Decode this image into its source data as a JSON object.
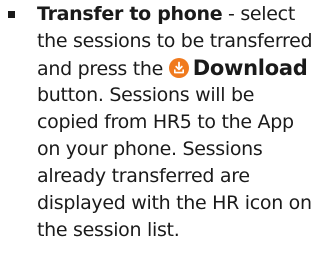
{
  "bullet": {
    "title": "Transfer to phone",
    "line1_rest": " - select",
    "line2": "the sessions to be transferred",
    "line3_prefix": "and press the ",
    "download_label": "Download",
    "line4": "button. Sessions will be",
    "line5": "copied from HR5 to the App",
    "line6": "on your phone. Sessions",
    "line7": "already transferred are",
    "line8": "displayed with the HR icon on",
    "line9": "the session list."
  },
  "icons": {
    "download_icon": "download-icon",
    "accent_color": "#F07A1E"
  }
}
